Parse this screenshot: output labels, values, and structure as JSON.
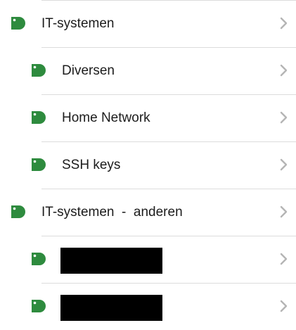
{
  "colors": {
    "tag": "#2e8b3e",
    "chevron": "#b5b5b5",
    "divider": "#dcdcdc",
    "text": "#1c1c1c"
  },
  "icons": {
    "tag": "tag-icon",
    "chevron": "chevron-right-icon"
  },
  "items": [
    {
      "label": "IT-systemen",
      "level": 1
    },
    {
      "label": "Diversen",
      "level": 2
    },
    {
      "label": "Home Network",
      "level": 2
    },
    {
      "label": "SSH keys",
      "level": 2
    },
    {
      "label": "IT-systemen  -  anderen",
      "level": 1
    },
    {
      "label": "",
      "level": 2,
      "redacted": true
    },
    {
      "label": "",
      "level": 2,
      "redacted": true
    }
  ]
}
